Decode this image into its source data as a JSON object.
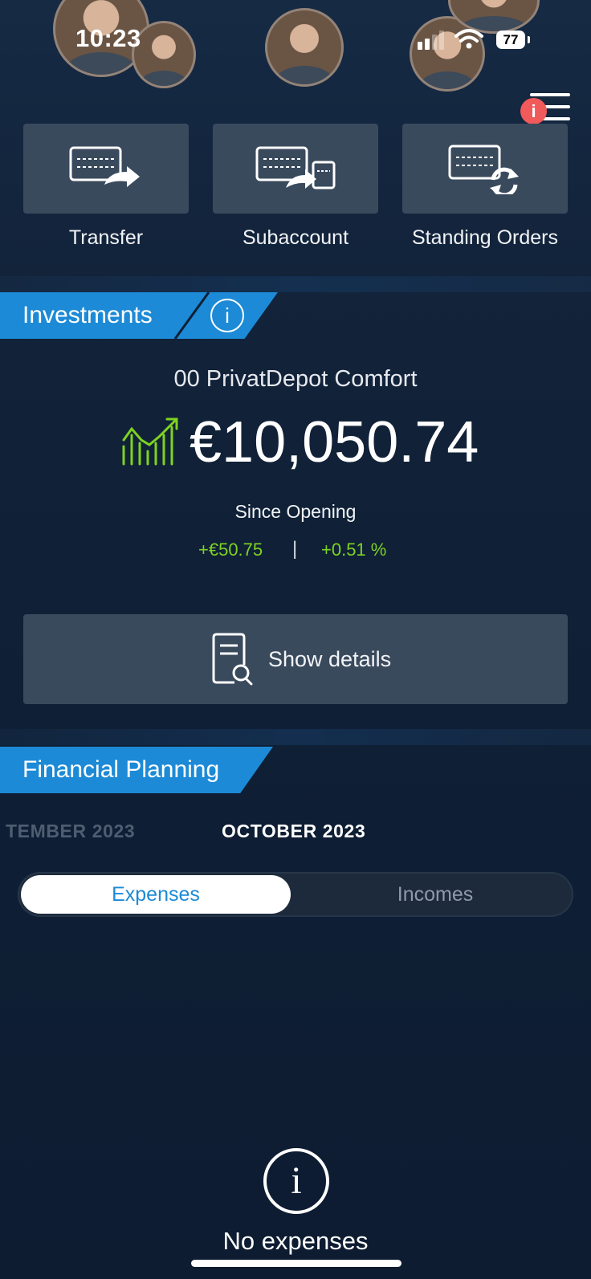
{
  "status_bar": {
    "time": "10:23",
    "battery": "77"
  },
  "menu": {
    "badge": "i"
  },
  "actions": [
    {
      "label": "Transfer"
    },
    {
      "label": "Subaccount"
    },
    {
      "label": "Standing Orders"
    }
  ],
  "investments": {
    "title": "Investments",
    "info": "i",
    "depot_name": "00 PrivatDepot Comfort",
    "balance": "€10,050.74",
    "since_label": "Since Opening",
    "change_abs": "+€50.75",
    "separator": "|",
    "change_pct": "+0.51 %",
    "details_label": "Show details"
  },
  "planning": {
    "title": "Financial Planning",
    "prev_month": "TEMBER 2023",
    "current_month": "OCTOBER 2023",
    "tabs": [
      "Expenses",
      "Incomes"
    ],
    "empty_icon": "i",
    "empty_text": "No expenses"
  },
  "colors": {
    "accent": "#1c8ad6",
    "positive": "#7ed321",
    "tile": "#3a4a5d",
    "badge": "#f05a5a"
  }
}
